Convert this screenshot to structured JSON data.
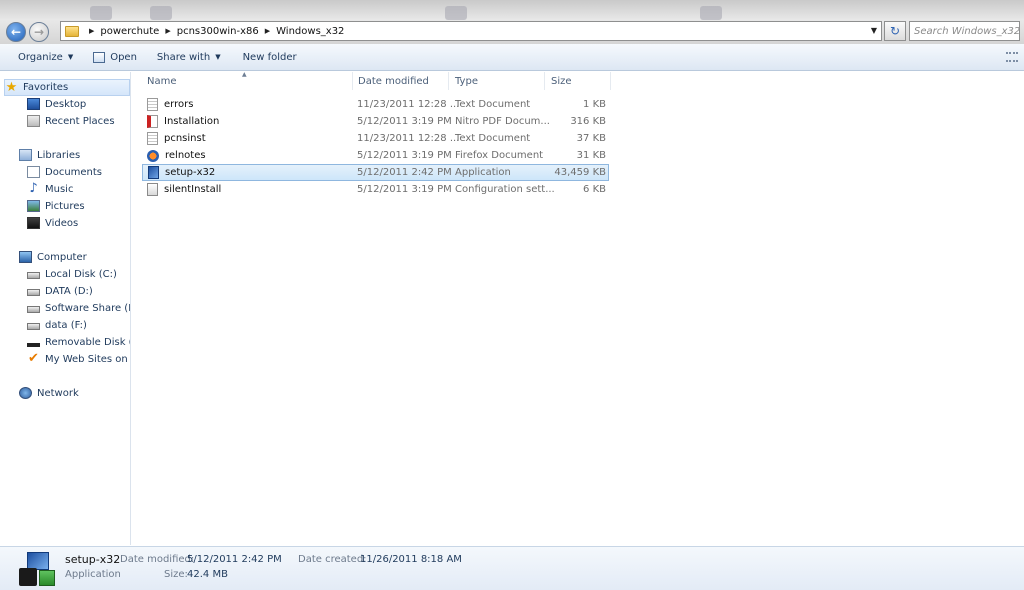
{
  "address": {
    "crumbs": [
      "powerchute",
      "pcns300win-x86",
      "Windows_x32"
    ],
    "search_placeholder": "Search Windows_x32"
  },
  "toolbar": {
    "organize": "Organize",
    "open": "Open",
    "share_with": "Share with",
    "new_folder": "New folder"
  },
  "nav": {
    "favorites": "Favorites",
    "desktop": "Desktop",
    "recent_places": "Recent Places",
    "libraries": "Libraries",
    "documents": "Documents",
    "music": "Music",
    "pictures": "Pictures",
    "videos": "Videos",
    "computer": "Computer",
    "drives": [
      "Local Disk (C:)",
      "DATA (D:)",
      "Software Share (E:)",
      "data (F:)",
      "Removable Disk (J:)",
      "My Web Sites on MS"
    ],
    "network": "Network"
  },
  "columns": {
    "name": "Name",
    "date_modified": "Date modified",
    "type": "Type",
    "size": "Size"
  },
  "files": [
    {
      "name": "errors",
      "date": "11/23/2011 12:28 ...",
      "type": "Text Document",
      "size": "1 KB",
      "icon": "text-file-icon"
    },
    {
      "name": "Installation",
      "date": "5/12/2011 3:19 PM",
      "type": "Nitro PDF Docum...",
      "size": "316 KB",
      "icon": "pdf-file-icon"
    },
    {
      "name": "pcnsinst",
      "date": "11/23/2011 12:28 ...",
      "type": "Text Document",
      "size": "37 KB",
      "icon": "text-file-icon"
    },
    {
      "name": "relnotes",
      "date": "5/12/2011 3:19 PM",
      "type": "Firefox Document",
      "size": "31 KB",
      "icon": "firefox-file-icon"
    },
    {
      "name": "setup-x32",
      "date": "5/12/2011 2:42 PM",
      "type": "Application",
      "size": "43,459 KB",
      "icon": "application-icon",
      "selected": true
    },
    {
      "name": "silentInstall",
      "date": "5/12/2011 3:19 PM",
      "type": "Configuration sett...",
      "size": "6 KB",
      "icon": "config-file-icon"
    }
  ],
  "details": {
    "name": "setup-x32",
    "type": "Application",
    "date_modified_label": "Date modified:",
    "date_modified": "5/12/2011 2:42 PM",
    "size_label": "Size:",
    "size": "42.4 MB",
    "date_created_label": "Date created:",
    "date_created": "11/26/2011 8:18 AM"
  }
}
